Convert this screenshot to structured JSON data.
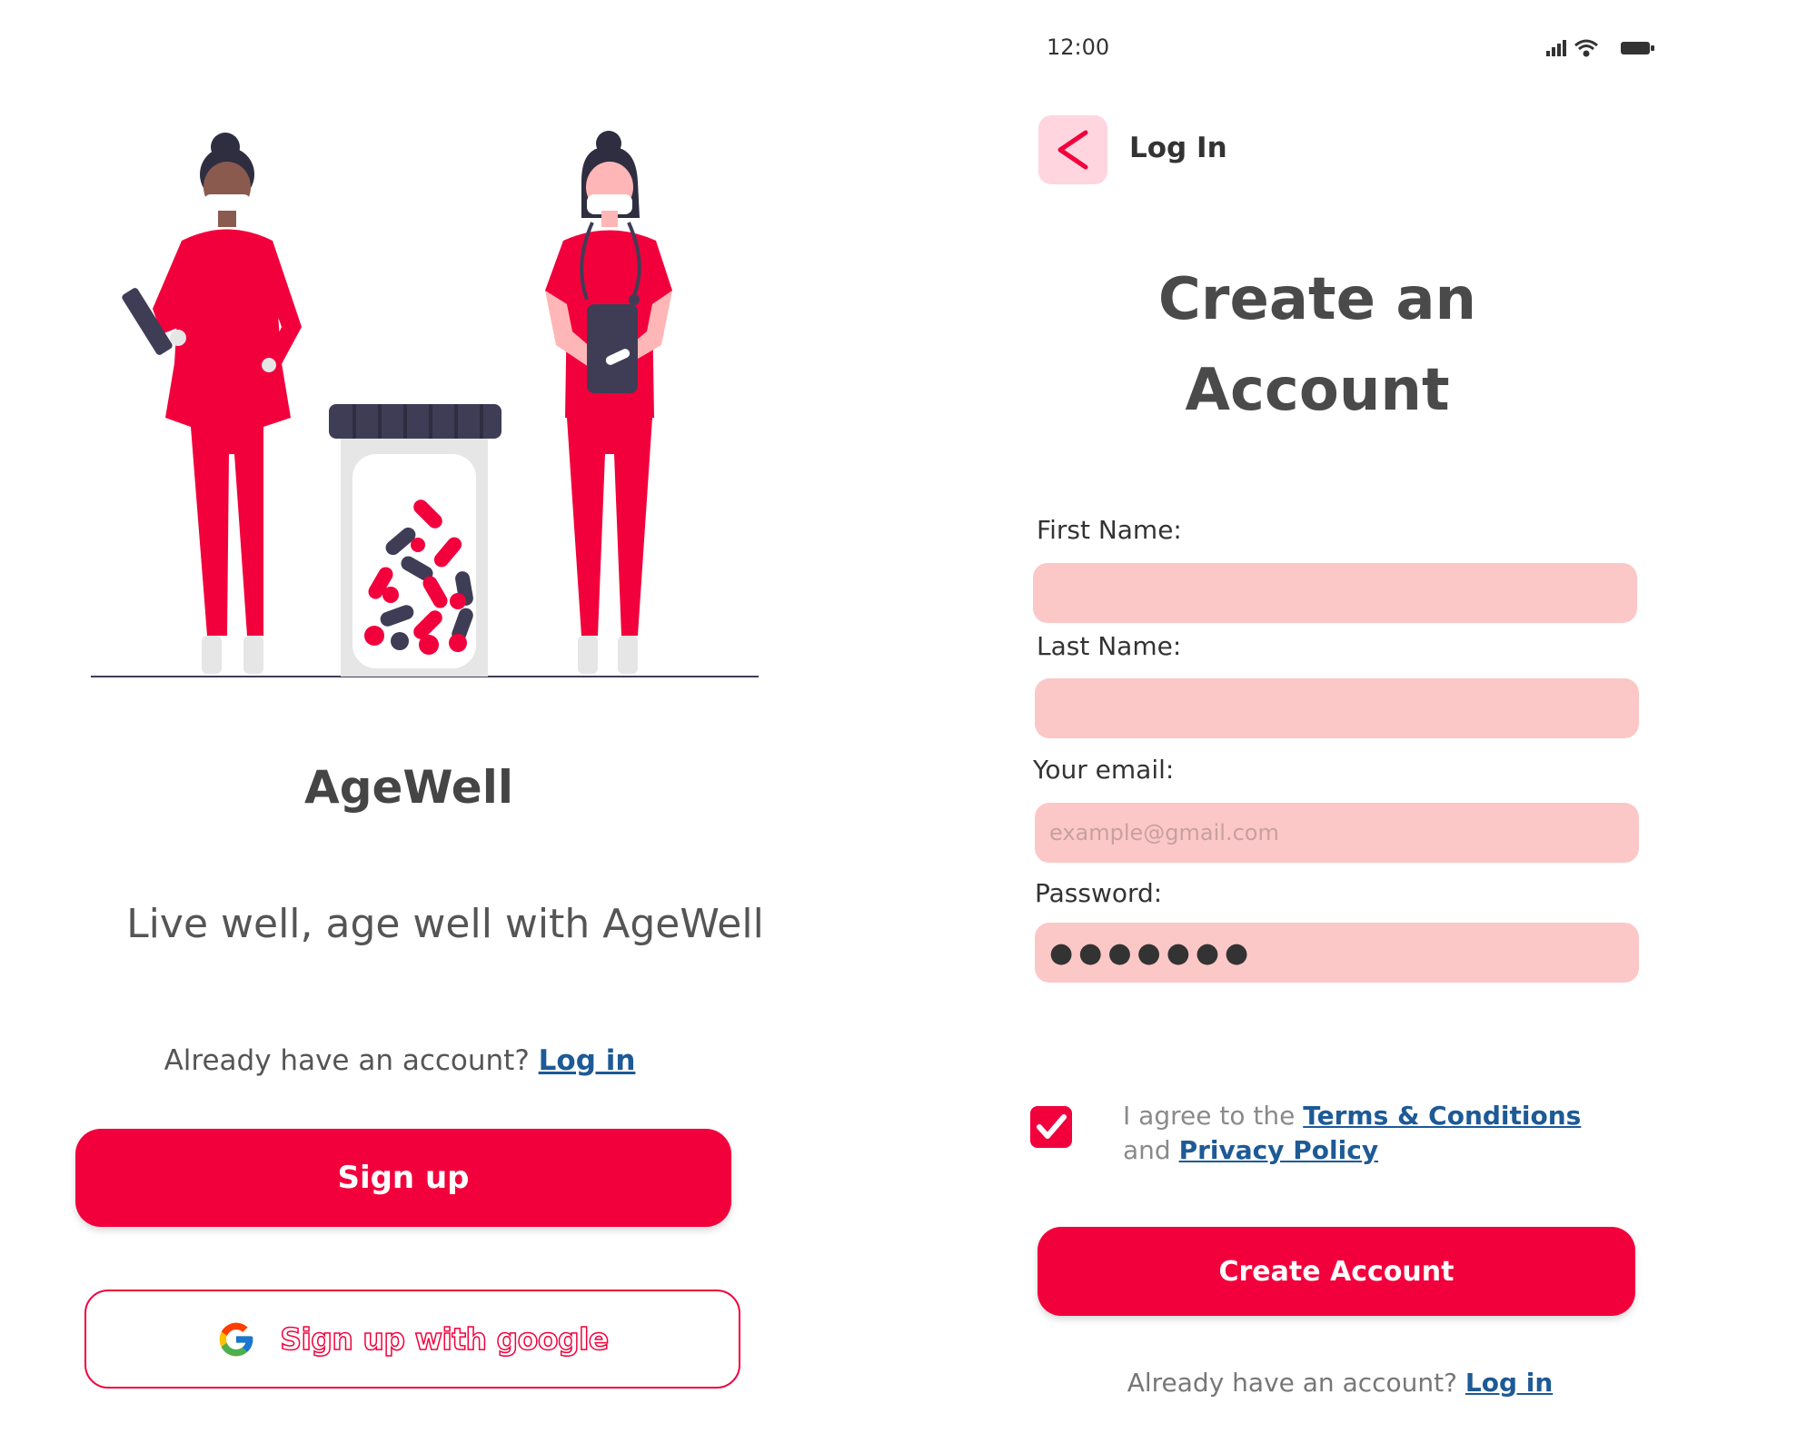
{
  "left_screen": {
    "app_name": "AgeWell",
    "tagline": "Live well, age well with AgeWell",
    "already_prompt": "Already have an account?",
    "login_link": "Log in",
    "signup_button": "Sign up",
    "google_button": "Sign up with google",
    "illustration_icon": "nurses-with-pill-jar-illustration"
  },
  "right_screen": {
    "status_bar": {
      "time": "12:00"
    },
    "nav": {
      "back_icon": "chevron-left-icon",
      "title": "Log In"
    },
    "title_line1": "Create an",
    "title_line2": "Account",
    "form": {
      "first_name_label": "First Name:",
      "first_name_value": "",
      "last_name_label": "Last Name:",
      "last_name_value": "",
      "email_label": "Your email:",
      "email_placeholder": "example@gmail.com",
      "password_label": "Password:",
      "password_mask": "●●●●●●●"
    },
    "agree": {
      "checked": true,
      "prefix": "I agree to the",
      "terms_link": "Terms & Conditions",
      "conjunction": "and",
      "privacy_link": "Privacy Policy"
    },
    "create_button": "Create Account",
    "already_prompt": "Already have an account?",
    "login_link": "Log in"
  },
  "colors": {
    "brand_red": "#f2003c",
    "field_pink": "#fcc7c7",
    "back_button_bg": "#ffd6df",
    "link_blue": "#1d5a96",
    "dark_navy": "#3f3d56"
  }
}
